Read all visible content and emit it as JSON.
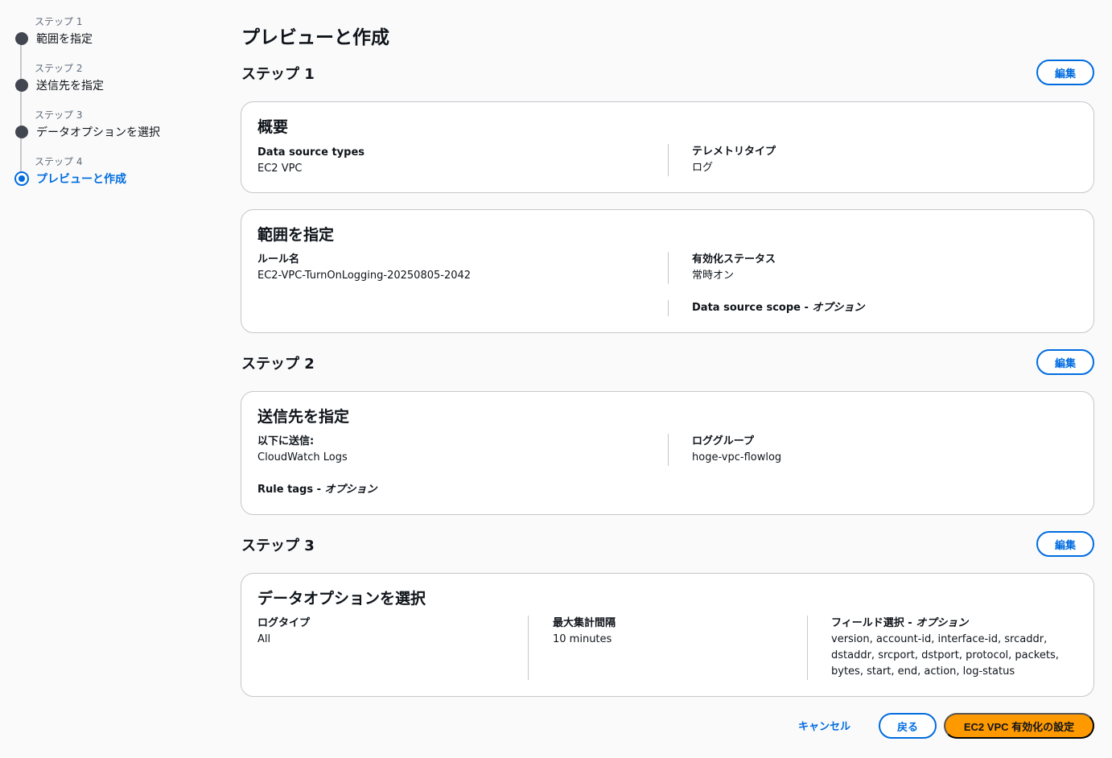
{
  "sidebar": {
    "steps": [
      {
        "num": "ステップ 1",
        "title": "範囲を指定"
      },
      {
        "num": "ステップ 2",
        "title": "送信先を指定"
      },
      {
        "num": "ステップ 3",
        "title": "データオプションを選択"
      },
      {
        "num": "ステップ 4",
        "title": "プレビューと作成"
      }
    ]
  },
  "main": {
    "title": "プレビューと作成",
    "edit_label": "編集",
    "step1": {
      "header": "ステップ 1",
      "overview": {
        "title": "概要",
        "data_source_types_label": "Data source types",
        "data_source_types_value": "EC2 VPC",
        "telemetry_type_label": "テレメトリタイプ",
        "telemetry_type_value": "ログ"
      },
      "scope": {
        "title": "範囲を指定",
        "rule_name_label": "ルール名",
        "rule_name_value": "EC2-VPC-TurnOnLogging-20250805-2042",
        "status_label": "有効化ステータス",
        "status_value": "常時オン",
        "data_source_scope_label": "Data source scope - ",
        "optional": "オプション"
      }
    },
    "step2": {
      "header": "ステップ 2",
      "destination": {
        "title": "送信先を指定",
        "send_to_label": "以下に送信:",
        "send_to_value": "CloudWatch Logs",
        "log_group_label": "ロググループ",
        "log_group_value": "hoge-vpc-flowlog",
        "rule_tags_label": "Rule tags - ",
        "optional": "オプション"
      }
    },
    "step3": {
      "header": "ステップ 3",
      "data_options": {
        "title": "データオプションを選択",
        "log_type_label": "ログタイプ",
        "log_type_value": "All",
        "max_agg_label": "最大集計間隔",
        "max_agg_value": "10 minutes",
        "fields_label": "フィールド選択 - ",
        "optional": "オプション",
        "fields_value": "version, account-id, interface-id, srcaddr, dstaddr, srcport, dstport, protocol, packets, bytes, start, end, action, log-status"
      }
    }
  },
  "footer": {
    "cancel": "キャンセル",
    "back": "戻る",
    "submit": "EC2 VPC 有効化の設定"
  },
  "colors": {
    "accent": "#006ce0",
    "primary_button": "#ff9900",
    "completed_dot": "#424650"
  }
}
